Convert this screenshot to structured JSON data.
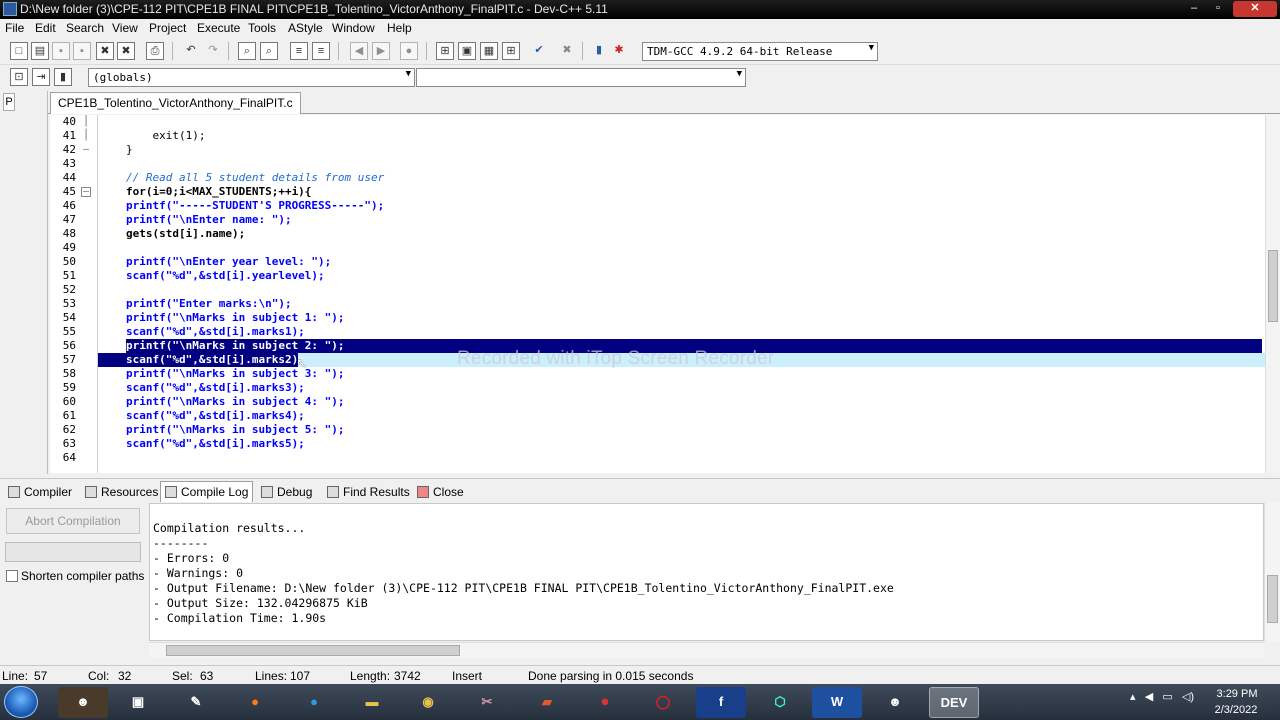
{
  "window": {
    "title": "D:\\New folder (3)\\CPE-112 PIT\\CPE1B FINAL PIT\\CPE1B_Tolentino_VictorAnthony_FinalPIT.c - Dev-C++ 5.11",
    "min": "–",
    "max": "▫",
    "close": "✕"
  },
  "menu": [
    "File",
    "Edit",
    "Search",
    "View",
    "Project",
    "Execute",
    "Tools",
    "AStyle",
    "Window",
    "Help"
  ],
  "toolbar": {
    "compiler_select": "TDM-GCC 4.9.2 64-bit Release",
    "scope_select": "(globals)",
    "function_select": ""
  },
  "left_panel": {
    "tab": "P"
  },
  "editor": {
    "file_tab": "CPE1B_Tolentino_VictorAnthony_FinalPIT.c",
    "lines": [
      {
        "n": "40",
        "text": ""
      },
      {
        "n": "41",
        "text": "    exit(1);"
      },
      {
        "n": "42",
        "text": "}"
      },
      {
        "n": "43",
        "text": ""
      },
      {
        "n": "44",
        "text": "// Read all 5 student details from user"
      },
      {
        "n": "45",
        "text": "for(i=0;i<MAX_STUDENTS;++i){"
      },
      {
        "n": "46",
        "text": "printf(\"-----STUDENT'S PROGRESS-----\");"
      },
      {
        "n": "47",
        "text": "printf(\"\\nEnter name: \");"
      },
      {
        "n": "48",
        "text": "gets(std[i].name);"
      },
      {
        "n": "49",
        "text": ""
      },
      {
        "n": "50",
        "text": "printf(\"\\nEnter year level: \");"
      },
      {
        "n": "51",
        "text": "scanf(\"%d\",&std[i].yearlevel);"
      },
      {
        "n": "52",
        "text": ""
      },
      {
        "n": "53",
        "text": "printf(\"Enter marks:\\n\");"
      },
      {
        "n": "54",
        "text": "printf(\"\\nMarks in subject 1: \");"
      },
      {
        "n": "55",
        "text": "scanf(\"%d\",&std[i].marks1);"
      },
      {
        "n": "56",
        "text": "printf(\"\\nMarks in subject 2: \");"
      },
      {
        "n": "57",
        "text": "scanf(\"%d\",&std[i].marks2);"
      },
      {
        "n": "58",
        "text": "printf(\"\\nMarks in subject 3: \");"
      },
      {
        "n": "59",
        "text": "scanf(\"%d\",&std[i].marks3);"
      },
      {
        "n": "60",
        "text": "printf(\"\\nMarks in subject 4: \");"
      },
      {
        "n": "61",
        "text": "scanf(\"%d\",&std[i].marks4);"
      },
      {
        "n": "62",
        "text": "printf(\"\\nMarks in subject 5: \");"
      },
      {
        "n": "63",
        "text": "scanf(\"%d\",&std[i].marks5);"
      },
      {
        "n": "64",
        "text": ""
      }
    ],
    "watermark": "Recorded with iTop Screen Recorder"
  },
  "bottom_tabs": [
    "Compiler",
    "Resources",
    "Compile Log",
    "Debug",
    "Find Results",
    "Close"
  ],
  "compile_panel": {
    "abort_button": "Abort Compilation",
    "shorten_label": "Shorten compiler paths",
    "log": [
      "Compilation results...",
      "--------",
      "- Errors: 0",
      "- Warnings: 0",
      "- Output Filename: D:\\New folder (3)\\CPE-112 PIT\\CPE1B FINAL PIT\\CPE1B_Tolentino_VictorAnthony_FinalPIT.exe",
      "- Output Size: 132.04296875 KiB",
      "- Compilation Time: 1.90s"
    ]
  },
  "status": {
    "line_label": "Line:",
    "line": "57",
    "col_label": "Col:",
    "col": "32",
    "sel_label": "Sel:",
    "sel": "63",
    "lines_label": "Lines:",
    "lines": "107",
    "length_label": "Length:",
    "length": "3742",
    "mode": "Insert",
    "message": "Done parsing in 0.015 seconds"
  },
  "taskbar": {
    "devcpp_label": "DEV",
    "word_label": "W",
    "facebook_label": "f",
    "time": "3:29 PM",
    "date": "2/3/2022"
  }
}
